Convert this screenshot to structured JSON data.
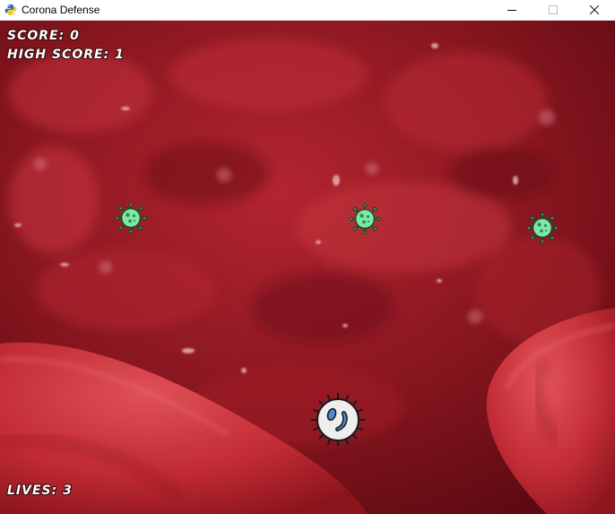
{
  "window": {
    "title": "Corona Defense",
    "app_icon": "python-snake-icon",
    "controls": [
      "minimize-icon",
      "maximize-icon",
      "close-icon"
    ]
  },
  "hud": {
    "score_label": "SCORE: 0",
    "high_score_label": "HIGH SCORE: 1",
    "lives_label": "LIVES: 3"
  },
  "enemies": [
    {
      "name": "green-virus-enemy",
      "icon": "virus-icon",
      "color": "#7ee8a2"
    },
    {
      "name": "green-virus-enemy",
      "icon": "virus-icon",
      "color": "#7ee8a2"
    },
    {
      "name": "green-virus-enemy",
      "icon": "virus-icon",
      "color": "#7ee8a2"
    }
  ],
  "player": {
    "name": "white-blood-cell",
    "icon": "white-blood-cell-icon",
    "color": "#eeeeee",
    "nucleus_color": "#4a8fd8"
  },
  "colors": {
    "background": "#a8202a",
    "background_dark": "#5e0a12",
    "virus_outline": "#1e4a2e"
  }
}
